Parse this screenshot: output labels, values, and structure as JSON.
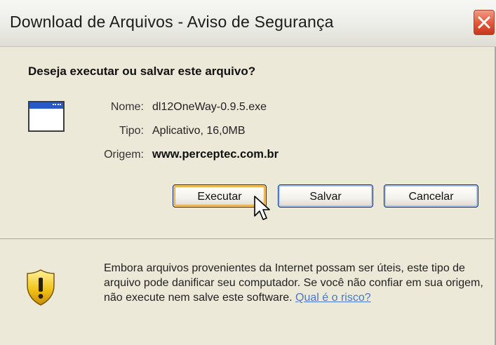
{
  "window": {
    "title": "Download de Arquivos - Aviso de Segurança"
  },
  "dialog": {
    "question": "Deseja executar ou salvar este arquivo?",
    "file": {
      "name_label": "Nome:",
      "name_value": "dl12OneWay-0.9.5.exe",
      "type_label": "Tipo:",
      "type_value": "Aplicativo, 16,0MB",
      "origin_label": "Origem:",
      "origin_value": "www.perceptec.com.br"
    },
    "buttons": {
      "run": "Executar",
      "save": "Salvar",
      "cancel": "Cancelar"
    },
    "warning": {
      "text": "Embora arquivos provenientes da Internet possam ser úteis, este tipo de arquivo pode danificar seu computador. Se você não confiar em sua origem, não execute nem salve este software. ",
      "link": "Qual é o risco?"
    }
  },
  "icons": {
    "close": "close-icon",
    "app": "application-window-icon",
    "shield": "warning-shield-icon",
    "cursor": "mouse-pointer-icon"
  },
  "colors": {
    "dialog_bg": "#ece9d8",
    "close_red": "#e2553a",
    "button_border": "#12317a",
    "link": "#4a78c4",
    "shield_yellow": "#f2c418"
  }
}
